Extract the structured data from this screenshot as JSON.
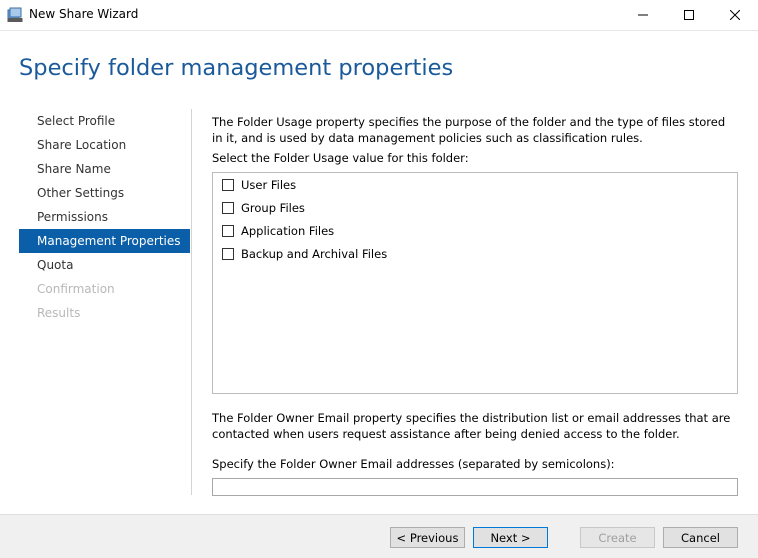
{
  "window": {
    "title": "New Share Wizard",
    "icons": {
      "app": "share-wizard-icon",
      "minimize": "minimize-icon",
      "maximize": "maximize-icon",
      "close": "close-icon"
    }
  },
  "page": {
    "title": "Specify folder management properties"
  },
  "nav": {
    "items": [
      {
        "label": "Select Profile",
        "state": "normal"
      },
      {
        "label": "Share Location",
        "state": "normal"
      },
      {
        "label": "Share Name",
        "state": "normal"
      },
      {
        "label": "Other Settings",
        "state": "normal"
      },
      {
        "label": "Permissions",
        "state": "normal"
      },
      {
        "label": "Management Properties",
        "state": "active"
      },
      {
        "label": "Quota",
        "state": "normal"
      },
      {
        "label": "Confirmation",
        "state": "disabled"
      },
      {
        "label": "Results",
        "state": "disabled"
      }
    ]
  },
  "content": {
    "usage_description": "The Folder Usage property specifies the purpose of the folder and the type of files stored in it, and is used by data management policies such as classification rules.",
    "usage_label": "Select the Folder Usage value for this folder:",
    "usage_options": [
      {
        "label": "User Files",
        "checked": false
      },
      {
        "label": "Group Files",
        "checked": false
      },
      {
        "label": "Application Files",
        "checked": false
      },
      {
        "label": "Backup and Archival Files",
        "checked": false
      }
    ],
    "owner_description": "The Folder Owner Email property specifies the distribution list or email addresses that are contacted when users request assistance after being denied access to the folder.",
    "email_label": "Specify the Folder Owner Email addresses (separated by semicolons):",
    "email_value": ""
  },
  "buttons": {
    "previous": "< Previous",
    "next": "Next >",
    "create": "Create",
    "cancel": "Cancel"
  },
  "colors": {
    "accent": "#0b5fa8",
    "title": "#1a5a9a",
    "disabled_text": "#b8b8b8"
  }
}
